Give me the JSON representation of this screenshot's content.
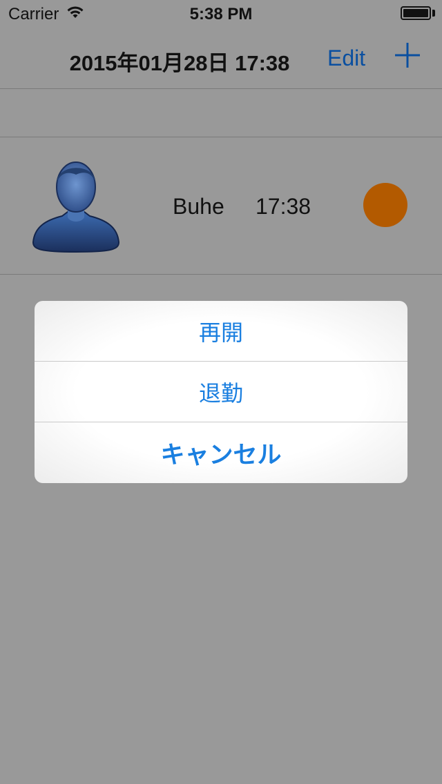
{
  "status_bar": {
    "carrier": "Carrier",
    "time": "5:38 PM",
    "wifi_icon": "wifi-icon",
    "battery_icon": "battery-icon"
  },
  "nav_bar": {
    "title": "2015年01月28日 17:38",
    "edit_label": "Edit",
    "add_icon": "plus-icon",
    "accent_color": "#0a4fa0"
  },
  "list": {
    "rows": [
      {
        "name": "Buhe",
        "time": "17:38",
        "avatar_icon": "person-avatar-icon",
        "status_color": "#b35a00"
      }
    ]
  },
  "action_sheet": {
    "resume_label": "再開",
    "leave_label": "退勤",
    "cancel_label": "キャンセル",
    "button_color": "#1a7fe0"
  }
}
